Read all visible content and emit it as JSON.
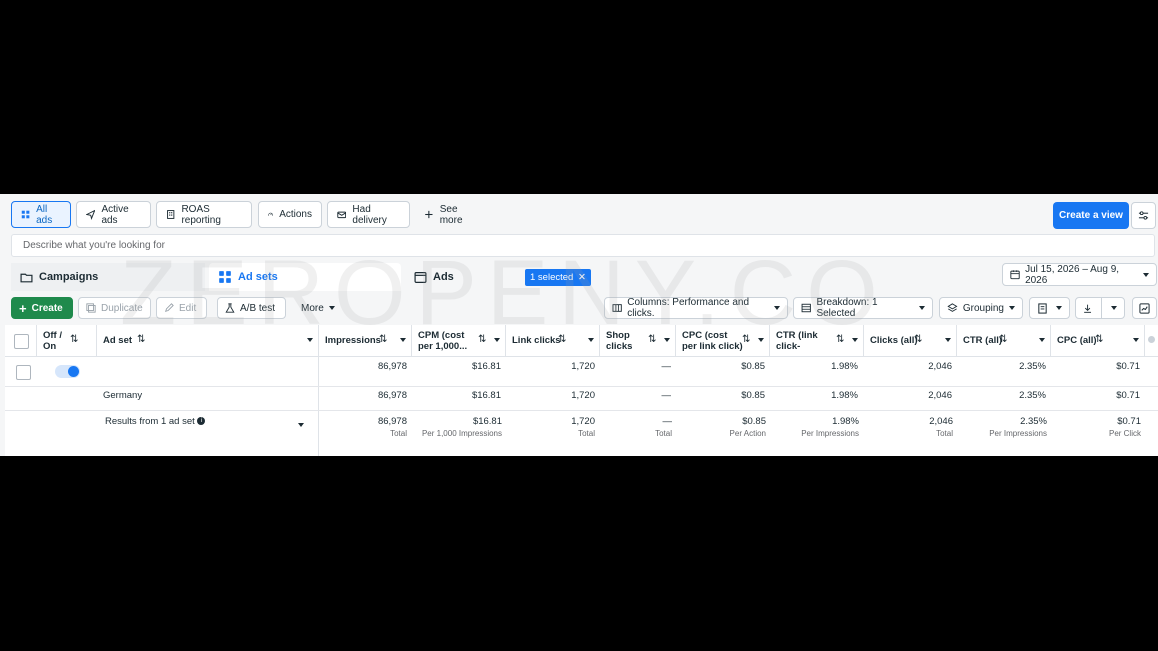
{
  "filters": [
    {
      "label": "All ads",
      "icon": "grid-icon",
      "active": true
    },
    {
      "label": "Active ads",
      "icon": "send-icon"
    },
    {
      "label": "ROAS reporting",
      "icon": "building-icon"
    },
    {
      "label": "Actions",
      "icon": "gauge-icon"
    },
    {
      "label": "Had delivery",
      "icon": "envelope-icon"
    },
    {
      "label": "See more",
      "icon": "plus-icon"
    }
  ],
  "create_view_label": "Create a view",
  "search_placeholder": "Describe what you're looking for",
  "tabs": {
    "campaigns": "Campaigns",
    "adsets": "Ad sets",
    "ads": "Ads",
    "selected_chip": "1 selected"
  },
  "date_range": "Jul 15, 2026 – Aug 9, 2026",
  "toolbar": {
    "create": "Create",
    "duplicate": "Duplicate",
    "edit": "Edit",
    "ab_test": "A/B test",
    "more": "More",
    "columns": "Columns: Performance and clicks.",
    "breakdown": "Breakdown: 1 Selected",
    "grouping": "Grouping"
  },
  "columns": {
    "off_on": "Off / On",
    "ad_set": "Ad set",
    "impressions": "Impressions",
    "cpm": "CPM (cost per 1,000...",
    "link_clicks": "Link clicks",
    "shop_clicks": "Shop clicks",
    "cpc_link": "CPC (cost per link click)",
    "ctr_link": "CTR (link click-throu...",
    "clicks_all": "Clicks (all)",
    "ctr_all": "CTR (all)",
    "cpc_all": "CPC (all)"
  },
  "rows": [
    {
      "name": "",
      "toggle": "on",
      "impressions": "86,978",
      "cpm": "$16.81",
      "link_clicks": "1,720",
      "shop_clicks": "—",
      "cpc_link": "$0.85",
      "ctr_link": "1.98%",
      "clicks_all": "2,046",
      "ctr_all": "2.35%",
      "cpc_all": "$0.71"
    },
    {
      "name": "Germany",
      "impressions": "86,978",
      "cpm": "$16.81",
      "link_clicks": "1,720",
      "shop_clicks": "—",
      "cpc_link": "$0.85",
      "ctr_link": "1.98%",
      "clicks_all": "2,046",
      "ctr_all": "2.35%",
      "cpc_all": "$0.71"
    }
  ],
  "summary": {
    "label": "Results from 1 ad set",
    "impressions": "86,978",
    "impressions_sub": "Total",
    "cpm": "$16.81",
    "cpm_sub": "Per 1,000 Impressions",
    "link_clicks": "1,720",
    "link_clicks_sub": "Total",
    "shop_clicks": "—",
    "shop_clicks_sub": "Total",
    "cpc_link": "$0.85",
    "cpc_link_sub": "Per Action",
    "ctr_link": "1.98%",
    "ctr_link_sub": "Per Impressions",
    "clicks_all": "2,046",
    "clicks_all_sub": "Total",
    "ctr_all": "2.35%",
    "ctr_all_sub": "Per Impressions",
    "cpc_all": "$0.71",
    "cpc_all_sub": "Per Click"
  },
  "watermark": "ZEROPENY.CO"
}
